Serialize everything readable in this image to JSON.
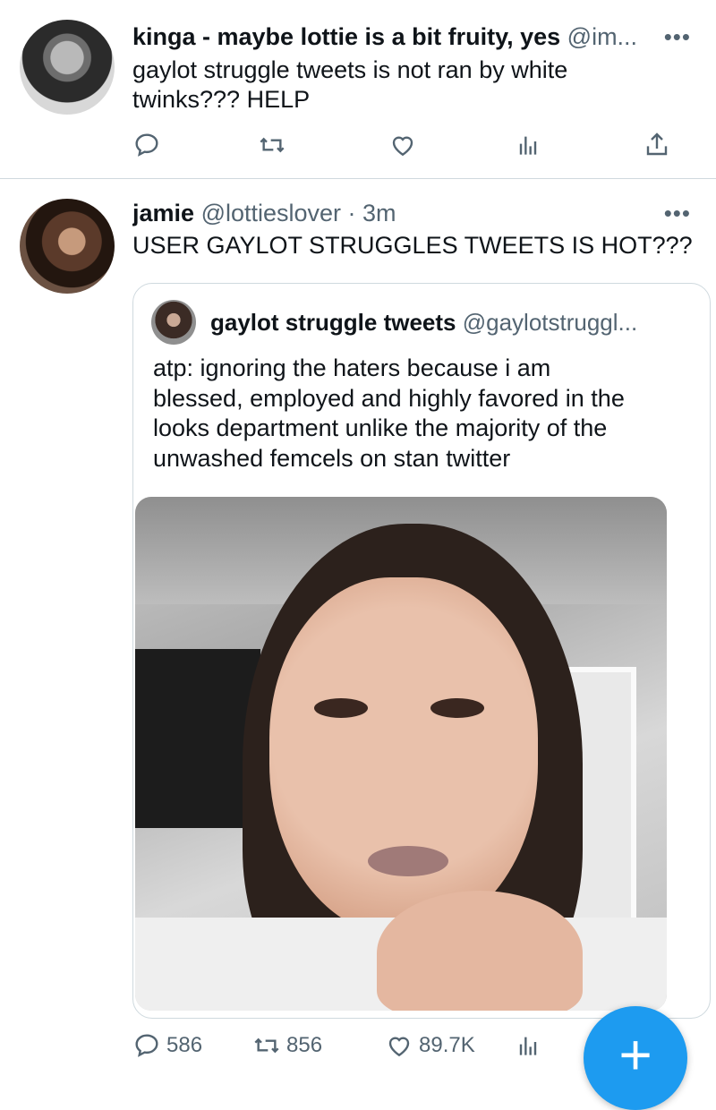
{
  "tweets": [
    {
      "name": "kinga - maybe lottie is a bit fruity, yes",
      "handle": "@im...",
      "text_lines": [
        "gaylot struggle tweets is not ran by white",
        "twinks??? HELP"
      ],
      "more": "•••",
      "actions": {
        "reply_count": "",
        "retweet_count": "",
        "like_count": ""
      }
    },
    {
      "name": "jamie",
      "handle": "@lottieslover",
      "time": "· 3m",
      "text": "USER GAYLOT STRUGGLES TWEETS IS HOT???",
      "more": "•••",
      "quote": {
        "name": "gaylot struggle tweets",
        "handle": "@gaylotstruggl...",
        "text_lines": [
          "atp: ignoring the haters because i am",
          "blessed, employed and highly favored in the",
          "looks department unlike the majority of the",
          "unwashed femcels on stan twitter"
        ]
      },
      "actions": {
        "reply_count": "586",
        "retweet_count": "856",
        "like_count": "89.7K"
      }
    }
  ],
  "fab": {
    "label": "+"
  },
  "colors": {
    "accent": "#1d9bf0",
    "secondary_text": "#536471",
    "border": "#cfd9de"
  }
}
